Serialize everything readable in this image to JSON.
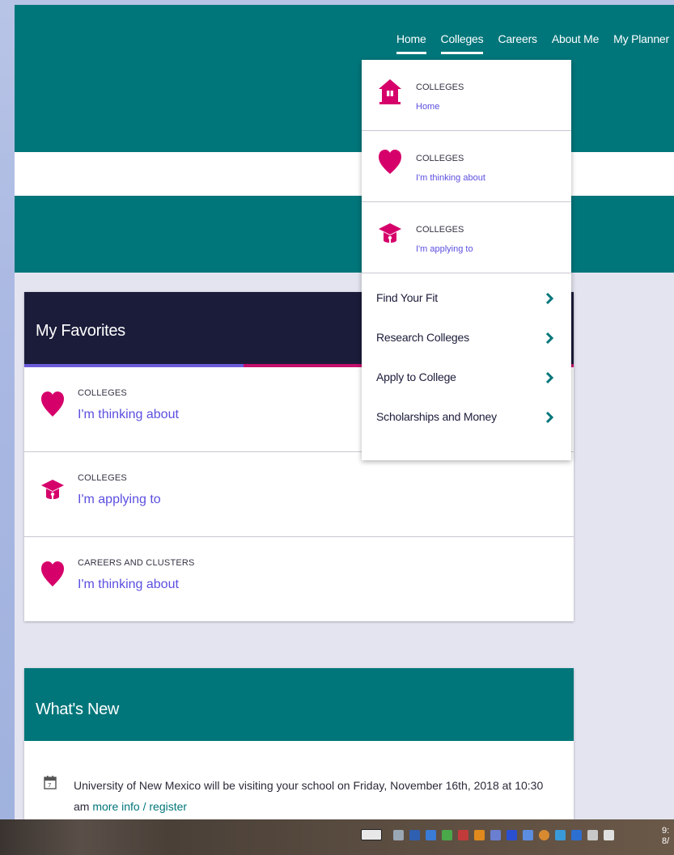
{
  "nav": {
    "items": [
      "Home",
      "Colleges",
      "Careers",
      "About Me",
      "My Planner"
    ]
  },
  "dropdown": {
    "items": [
      {
        "kicker": "COLLEGES",
        "sub": "Home",
        "icon": "house-icon"
      },
      {
        "kicker": "COLLEGES",
        "sub": "I'm thinking about",
        "icon": "heart-icon"
      },
      {
        "kicker": "COLLEGES",
        "sub": "I'm applying to",
        "icon": "graduation-cap-icon"
      }
    ],
    "links": [
      "Find Your Fit",
      "Research Colleges",
      "Apply to College",
      "Scholarships and Money"
    ]
  },
  "favorites": {
    "title": "My Favorites",
    "rows": [
      {
        "kicker": "COLLEGES",
        "link": "I'm thinking about",
        "icon": "heart-icon"
      },
      {
        "kicker": "COLLEGES",
        "link": "I'm applying to",
        "icon": "graduation-cap-icon"
      },
      {
        "kicker": "CAREERS AND CLUSTERS",
        "link": "I'm thinking about",
        "icon": "heart-icon"
      }
    ]
  },
  "whats_new": {
    "title": "What's New",
    "item_text": "University of New Mexico will be visiting your school on Friday, November 16th, 2018 at 10:30 am",
    "item_link": "more info / register"
  },
  "taskbar": {
    "clock_time": "9:",
    "clock_date": "8/"
  },
  "colors": {
    "teal": "#00767a",
    "navy": "#1b1c3a",
    "magenta": "#d6006b",
    "link_purple": "#5b4fe0"
  }
}
